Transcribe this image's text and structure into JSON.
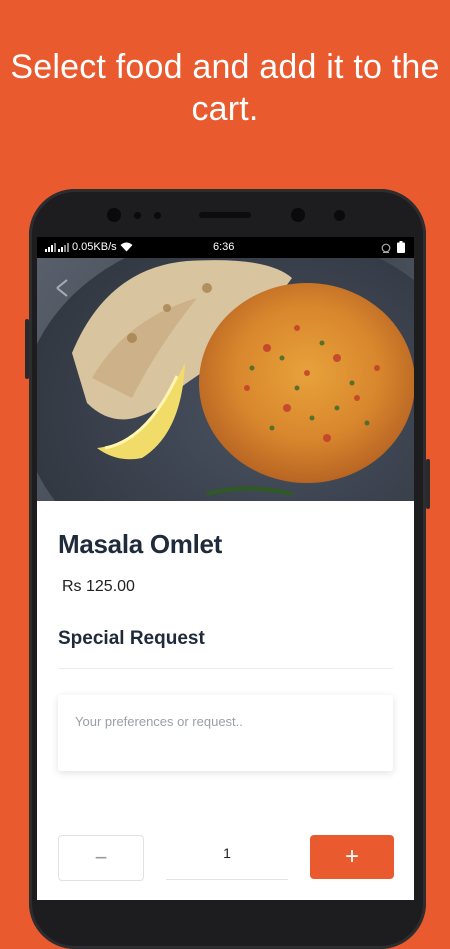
{
  "headline": "Select food and add it to the cart.",
  "status_bar": {
    "network_speed": "0.05KB/s",
    "time": "6:36"
  },
  "item": {
    "name": "Masala Omlet",
    "price": "Rs 125.00"
  },
  "special_request": {
    "heading": "Special Request",
    "placeholder": "Your preferences or request.."
  },
  "quantity": {
    "value": "1",
    "minus_label": "−",
    "plus_label": "+"
  },
  "colors": {
    "brand": "#E95A2F",
    "title_text": "#1f2a3a"
  }
}
